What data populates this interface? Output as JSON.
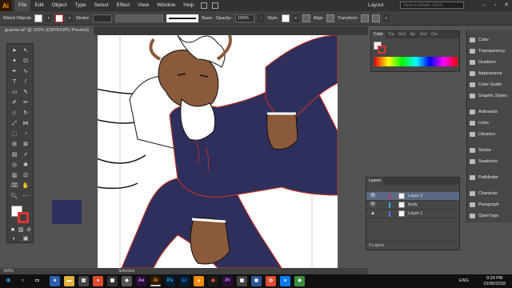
{
  "menubar": {
    "logo": "Ai",
    "items": [
      "File",
      "Edit",
      "Object",
      "Type",
      "Select",
      "Effect",
      "View",
      "Window",
      "Help"
    ],
    "layout_label": "Layout",
    "search_placeholder": "Search Adobe Stock"
  },
  "controlbar": {
    "selection_label": "Mixed Objects",
    "stroke_label": "Stroke:",
    "stroke_profile": "Basic",
    "opacity_label": "Opacity:",
    "opacity_value": "100%",
    "style_label": "Style:",
    "align_label": "Align",
    "transform_label": "Transform"
  },
  "document": {
    "tab_title": "guarrior.ai* @ 150% (CMYK/GPU Preview)",
    "zoom": "150%",
    "status_tool": "Selection"
  },
  "color_panel": {
    "tabs": [
      "Color",
      "Tra",
      "Grd",
      "Ap",
      "Grd",
      "Grs"
    ]
  },
  "layers_panel": {
    "title": "Layers",
    "layers": [
      {
        "name": "Layer 2",
        "color": "#e0336e"
      },
      {
        "name": "body",
        "color": "#3aa8ff"
      },
      {
        "name": "Layer 1",
        "color": "#4d7bff"
      }
    ],
    "footer": "3 Layers"
  },
  "right_dock": {
    "items": [
      "Color",
      "Transparency",
      "Gradient",
      "Appearance",
      "Color Guide",
      "Graphic Styles",
      "Artboards",
      "Links",
      "Libraries",
      "Stroke",
      "Swatches",
      "Pathfinder",
      "Character",
      "Paragraph",
      "OpenType"
    ]
  },
  "taskbar": {
    "lang": "ENG",
    "time": "9:29 PM",
    "date": "01/05/2018"
  },
  "colors": {
    "navy_suit": "#2e2f5c",
    "skin": "#8a5a3b",
    "outline_red": "#d9341f"
  }
}
